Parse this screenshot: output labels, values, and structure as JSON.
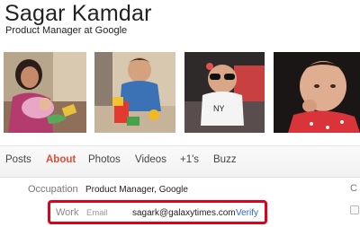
{
  "profile": {
    "name": "Sagar Kamdar",
    "tagline": "Product Manager at Google"
  },
  "tabs": [
    {
      "label": "Posts",
      "active": false
    },
    {
      "label": "About",
      "active": true
    },
    {
      "label": "Photos",
      "active": false
    },
    {
      "label": "Videos",
      "active": false
    },
    {
      "label": "+1's",
      "active": false
    },
    {
      "label": "Buzz",
      "active": false
    }
  ],
  "about": {
    "occupation_label": "Occupation",
    "occupation_value": "Product Manager, Google",
    "work_label": "Work",
    "email_label": "Email",
    "email_value": "sagark@galaxytimes.com",
    "verify_label": "Verify",
    "right_column_letter": "C"
  },
  "colors": {
    "active_tab": "#dd4b39",
    "highlight_box": "#e0001b",
    "link": "#2a67c1"
  }
}
